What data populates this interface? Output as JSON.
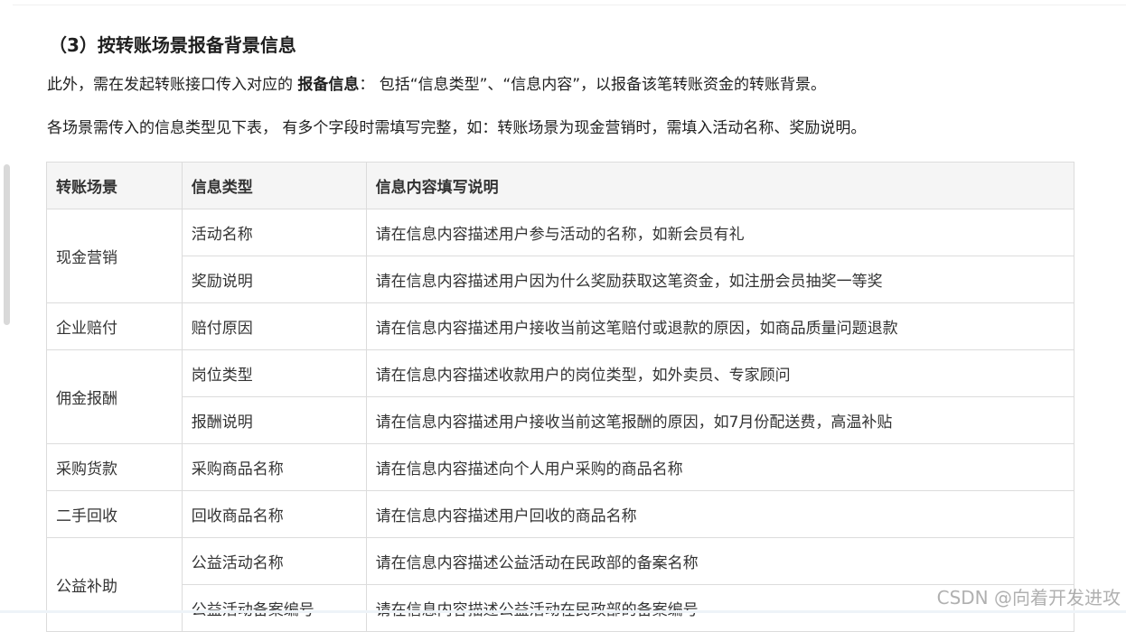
{
  "heading": "（3）按转账场景报备背景信息",
  "para1": {
    "prefix": "此外，需在发起转账接口传入对应的 ",
    "bold": "报备信息",
    "suffix": "： 包括“信息类型”、“信息内容”，以报备该笔转账资金的转账背景。"
  },
  "para2": "各场景需传入的信息类型见下表， 有多个字段时需填写完整，如：转账场景为现金营销时，需填入活动名称、奖励说明。",
  "table": {
    "headers": [
      "转账场景",
      "信息类型",
      "信息内容填写说明"
    ],
    "rows": [
      {
        "scenario": "现金营销",
        "type": "活动名称",
        "desc": "请在信息内容描述用户参与活动的名称，如新会员有礼"
      },
      {
        "type": "奖励说明",
        "desc": "请在信息内容描述用户因为什么奖励获取这笔资金，如注册会员抽奖一等奖"
      },
      {
        "scenario": "企业赔付",
        "type": "赔付原因",
        "desc": "请在信息内容描述用户接收当前这笔赔付或退款的原因，如商品质量问题退款"
      },
      {
        "scenario": "佣金报酬",
        "type": "岗位类型",
        "desc": "请在信息内容描述收款用户的岗位类型，如外卖员、专家顾问"
      },
      {
        "type": "报酬说明",
        "desc": "请在信息内容描述用户接收当前这笔报酬的原因，如7月份配送费，高温补贴"
      },
      {
        "scenario": "采购货款",
        "type": "采购商品名称",
        "desc": "请在信息内容描述向个人用户采购的商品名称"
      },
      {
        "scenario": "二手回收",
        "type": "回收商品名称",
        "desc": "请在信息内容描述用户回收的商品名称"
      },
      {
        "scenario": "公益补助",
        "type": "公益活动名称",
        "desc": "请在信息内容描述公益活动在民政部的备案名称"
      },
      {
        "type": "公益活动备案编号",
        "desc": "请在信息内容描述公益活动在民政部的备案编号"
      }
    ]
  },
  "watermark": "CSDN @向着开发进攻"
}
